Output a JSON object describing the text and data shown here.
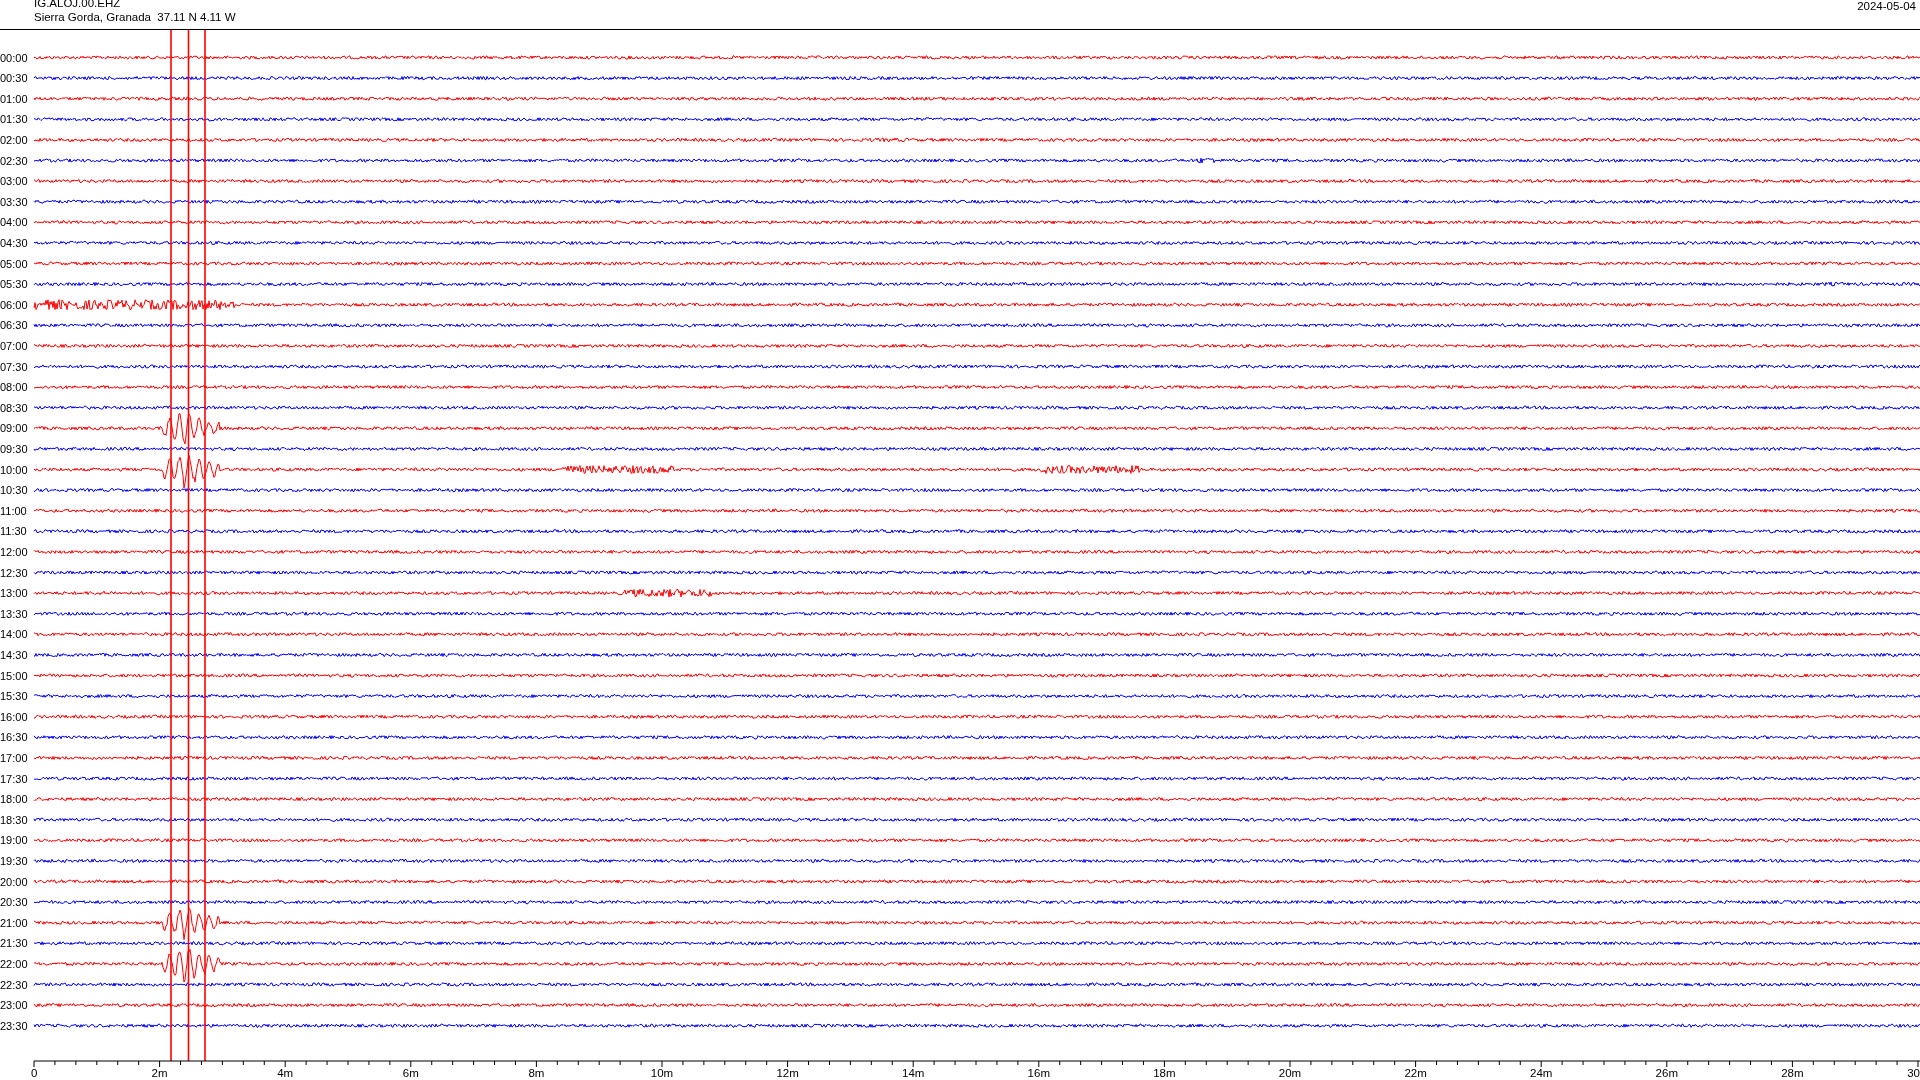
{
  "header": {
    "station": "IG.ALOJ.00.EHZ",
    "location": "Sierra Gorda, Granada  37.11 N 4.11 W",
    "date": "2024-05-04"
  },
  "helicorder": {
    "rows": [
      {
        "label": "00:00",
        "color": "#ff0000"
      },
      {
        "label": "00:30",
        "color": "#0000ff"
      },
      {
        "label": "01:00",
        "color": "#ff0000"
      },
      {
        "label": "01:30",
        "color": "#0000ff"
      },
      {
        "label": "02:00",
        "color": "#ff0000"
      },
      {
        "label": "02:30",
        "color": "#0000ff"
      },
      {
        "label": "03:00",
        "color": "#ff0000"
      },
      {
        "label": "03:30",
        "color": "#0000ff"
      },
      {
        "label": "04:00",
        "color": "#ff0000"
      },
      {
        "label": "04:30",
        "color": "#0000ff"
      },
      {
        "label": "05:00",
        "color": "#ff0000"
      },
      {
        "label": "05:30",
        "color": "#0000ff"
      },
      {
        "label": "06:00",
        "color": "#ff0000"
      },
      {
        "label": "06:30",
        "color": "#0000ff"
      },
      {
        "label": "07:00",
        "color": "#ff0000"
      },
      {
        "label": "07:30",
        "color": "#0000ff"
      },
      {
        "label": "08:00",
        "color": "#ff0000"
      },
      {
        "label": "08:30",
        "color": "#0000ff"
      },
      {
        "label": "09:00",
        "color": "#ff0000"
      },
      {
        "label": "09:30",
        "color": "#0000ff"
      },
      {
        "label": "10:00",
        "color": "#ff0000"
      },
      {
        "label": "10:30",
        "color": "#0000ff"
      },
      {
        "label": "11:00",
        "color": "#ff0000"
      },
      {
        "label": "11:30",
        "color": "#0000ff"
      },
      {
        "label": "12:00",
        "color": "#ff0000"
      },
      {
        "label": "12:30",
        "color": "#0000ff"
      },
      {
        "label": "13:00",
        "color": "#ff0000"
      },
      {
        "label": "13:30",
        "color": "#0000ff"
      },
      {
        "label": "14:00",
        "color": "#ff0000"
      },
      {
        "label": "14:30",
        "color": "#0000ff"
      },
      {
        "label": "15:00",
        "color": "#ff0000"
      },
      {
        "label": "15:30",
        "color": "#0000ff"
      },
      {
        "label": "16:00",
        "color": "#ff0000"
      },
      {
        "label": "16:30",
        "color": "#0000ff"
      },
      {
        "label": "17:00",
        "color": "#ff0000"
      },
      {
        "label": "17:30",
        "color": "#0000ff"
      },
      {
        "label": "18:00",
        "color": "#ff0000"
      },
      {
        "label": "18:30",
        "color": "#0000ff"
      },
      {
        "label": "19:00",
        "color": "#ff0000"
      },
      {
        "label": "19:30",
        "color": "#0000ff"
      },
      {
        "label": "20:00",
        "color": "#ff0000"
      },
      {
        "label": "20:30",
        "color": "#0000ff"
      },
      {
        "label": "21:00",
        "color": "#ff0000"
      },
      {
        "label": "21:30",
        "color": "#0000ff"
      },
      {
        "label": "22:00",
        "color": "#ff0000"
      },
      {
        "label": "22:30",
        "color": "#0000ff"
      },
      {
        "label": "23:00",
        "color": "#ff0000"
      },
      {
        "label": "23:30",
        "color": "#0000ff"
      }
    ],
    "x_ticks": [
      "0",
      "2m",
      "4m",
      "6m",
      "8m",
      "10m",
      "12m",
      "14m",
      "16m",
      "18m",
      "20m",
      "22m",
      "24m",
      "26m",
      "28m",
      "30"
    ]
  }
}
